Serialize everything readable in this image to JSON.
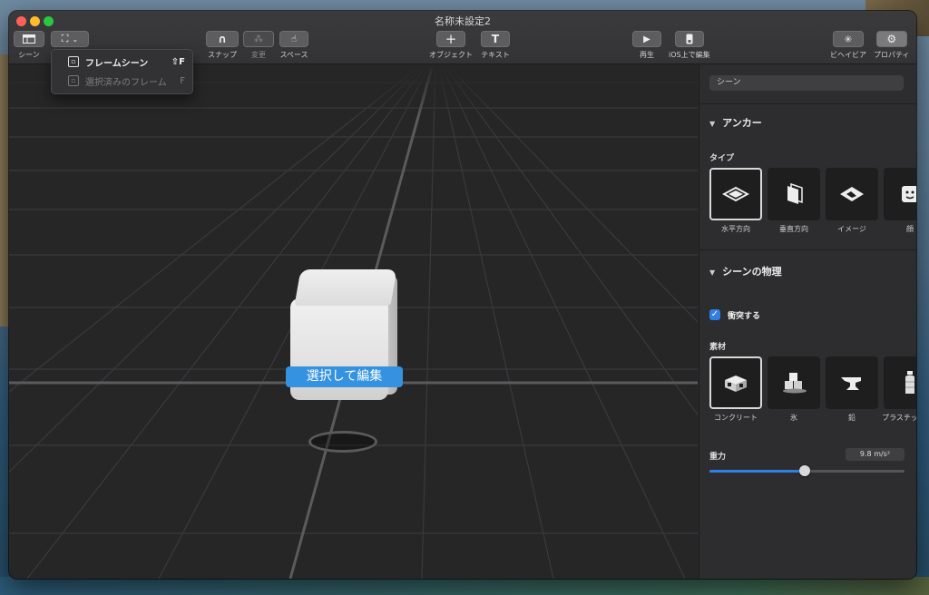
{
  "window": {
    "title": "名称未設定2"
  },
  "toolbar": {
    "scene_label": "シーン",
    "snap_label": "スナップ",
    "change_label": "変更",
    "space_label": "スペース",
    "object_label": "オブジェクト",
    "text_label": "テキスト",
    "play_label": "再生",
    "ios_edit_label": "iOS上で編集",
    "behavior_label": "ビヘイビア",
    "properties_label": "プロパティ"
  },
  "frame_menu": {
    "items": [
      {
        "label": "フレームシーン",
        "shortcut": "⇧F",
        "enabled": true
      },
      {
        "label": "選択済みのフレーム",
        "shortcut": "F",
        "enabled": false
      }
    ]
  },
  "viewport": {
    "select_edit_label": "選択して編集"
  },
  "panel": {
    "scene_name": "シーン",
    "anchor": {
      "title": "アンカー",
      "type_label": "タイプ",
      "types": [
        {
          "label": "水平方向",
          "icon": "horizontal-plane-icon",
          "selected": true
        },
        {
          "label": "垂直方向",
          "icon": "vertical-plane-icon",
          "selected": false
        },
        {
          "label": "イメージ",
          "icon": "image-anchor-icon",
          "selected": false
        },
        {
          "label": "顔",
          "icon": "face-anchor-icon",
          "selected": false
        }
      ]
    },
    "physics": {
      "title": "シーンの物理",
      "collide_label": "衝突する",
      "collide_checked": true,
      "material_label": "素材",
      "materials": [
        {
          "label": "コンクリート",
          "icon": "concrete-block-icon",
          "selected": true
        },
        {
          "label": "氷",
          "icon": "ice-cubes-icon",
          "selected": false
        },
        {
          "label": "鉛",
          "icon": "anvil-icon",
          "selected": false
        },
        {
          "label": "プラスチック",
          "icon": "bottle-icon",
          "selected": false
        }
      ],
      "gravity_label": "重力",
      "gravity_value": "9.8 m/s²",
      "gravity_slider_fraction": 0.49
    }
  }
}
